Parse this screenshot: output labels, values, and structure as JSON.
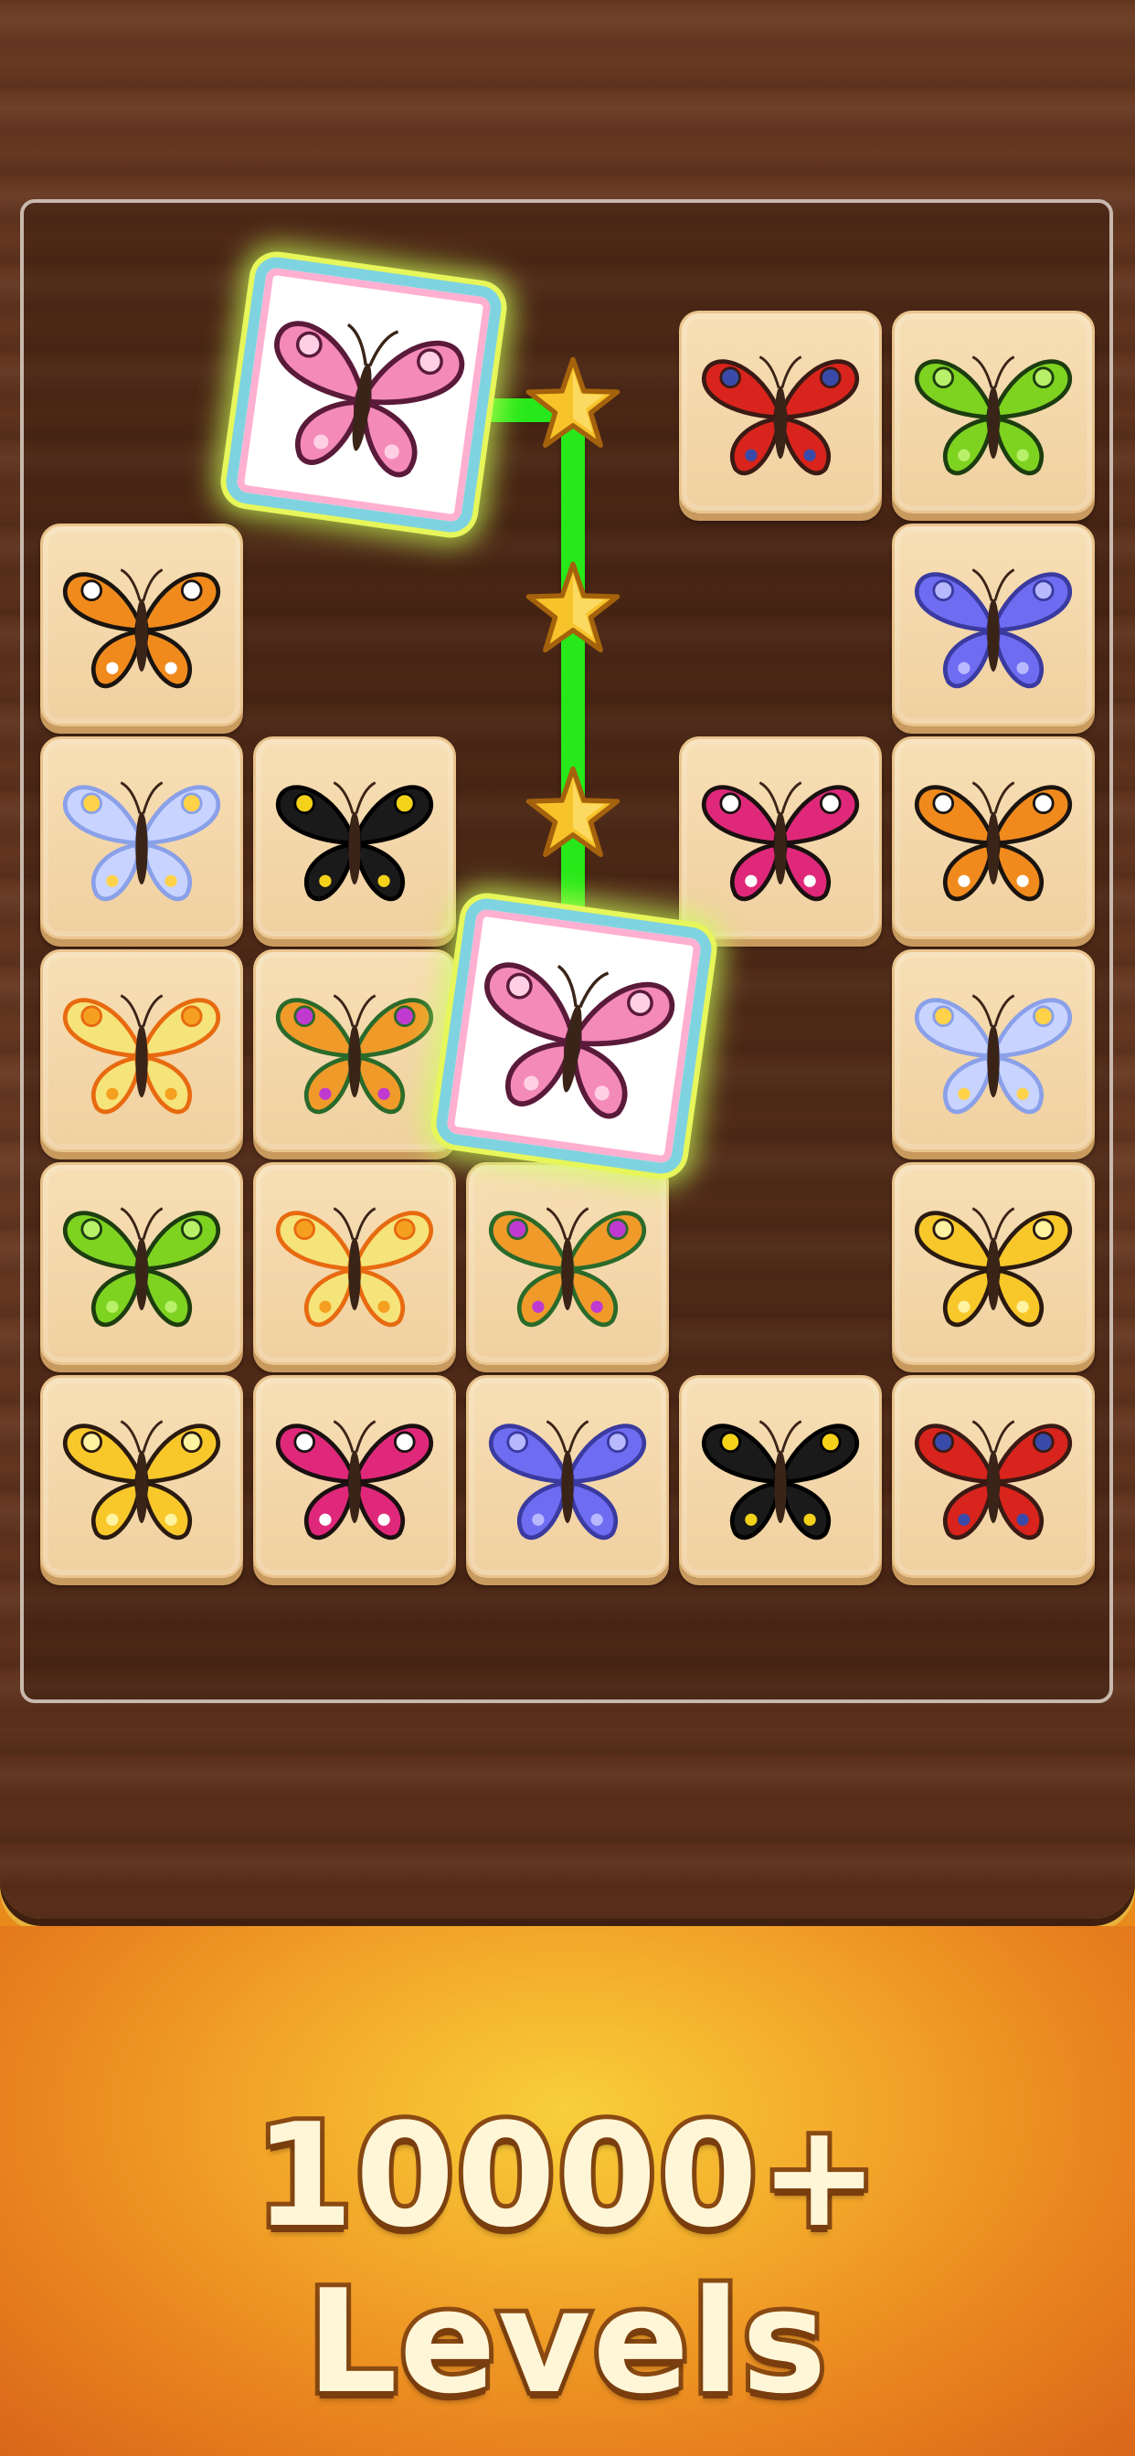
{
  "promo": {
    "headline": "10000+ Levels"
  },
  "board": {
    "cols": 5,
    "rows": 6,
    "tiles": [
      {
        "col": 3,
        "row": 0,
        "kind": "peacock"
      },
      {
        "col": 4,
        "row": 0,
        "kind": "green"
      },
      {
        "col": 0,
        "row": 1,
        "kind": "monarch"
      },
      {
        "col": 4,
        "row": 1,
        "kind": "violet"
      },
      {
        "col": 0,
        "row": 2,
        "kind": "paleblue"
      },
      {
        "col": 1,
        "row": 2,
        "kind": "blackyellow"
      },
      {
        "col": 3,
        "row": 2,
        "kind": "magenta"
      },
      {
        "col": 4,
        "row": 2,
        "kind": "monarch"
      },
      {
        "col": 0,
        "row": 3,
        "kind": "lemon"
      },
      {
        "col": 1,
        "row": 3,
        "kind": "rainbow"
      },
      {
        "col": 4,
        "row": 3,
        "kind": "paleblue"
      },
      {
        "col": 0,
        "row": 4,
        "kind": "green"
      },
      {
        "col": 1,
        "row": 4,
        "kind": "lemon"
      },
      {
        "col": 2,
        "row": 4,
        "kind": "rainbow"
      },
      {
        "col": 4,
        "row": 4,
        "kind": "yellow"
      },
      {
        "col": 0,
        "row": 5,
        "kind": "yellow"
      },
      {
        "col": 1,
        "row": 5,
        "kind": "magenta"
      },
      {
        "col": 2,
        "row": 5,
        "kind": "violet"
      },
      {
        "col": 3,
        "row": 5,
        "kind": "blackyellow"
      },
      {
        "col": 4,
        "row": 5,
        "kind": "peacock"
      }
    ],
    "selected_tiles": [
      {
        "id": "a",
        "kind": "pink"
      },
      {
        "id": "b",
        "kind": "pink"
      }
    ],
    "match_path_stars": 3
  },
  "colors": {
    "path": "#27e81a",
    "tile_face": "#f3d6a8",
    "wood": "#5c311b",
    "promo_orange": "#e8821e"
  },
  "butterfly_palettes": {
    "peacock": {
      "wing": "#d8241c",
      "edge": "#3a1a14",
      "spot": "#3a4aa8"
    },
    "green": {
      "wing": "#7ed321",
      "edge": "#1d3d10",
      "spot": "#b9f06a"
    },
    "monarch": {
      "wing": "#f08a1c",
      "edge": "#1a1410",
      "spot": "#ffffff"
    },
    "violet": {
      "wing": "#6e6cf0",
      "edge": "#3a3aa0",
      "spot": "#b8b8ff"
    },
    "paleblue": {
      "wing": "#c8d4ff",
      "edge": "#8aa0e8",
      "spot": "#ffd24a"
    },
    "blackyellow": {
      "wing": "#1a1a1a",
      "edge": "#000000",
      "spot": "#f5d21a"
    },
    "magenta": {
      "wing": "#e0287a",
      "edge": "#1a1010",
      "spot": "#ffffff"
    },
    "lemon": {
      "wing": "#f5e47a",
      "edge": "#e86a10",
      "spot": "#f5a020"
    },
    "rainbow": {
      "wing": "#f09a2a",
      "edge": "#2a6a2a",
      "spot": "#c03ad0"
    },
    "yellow": {
      "wing": "#f8c82a",
      "edge": "#2a1a10",
      "spot": "#fff2a0"
    },
    "pink": {
      "wing": "#f48ab8",
      "edge": "#5a1a3a",
      "spot": "#ffd0e4"
    }
  }
}
